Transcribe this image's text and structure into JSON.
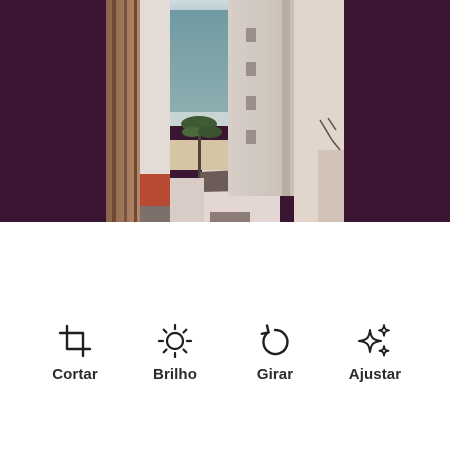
{
  "preview": {
    "background": "#3a1632",
    "image_content": "beach-street-view-photo"
  },
  "toolbar": {
    "icon_color": "#1f1f1f",
    "label_color": "#2b2b2b",
    "tools": [
      {
        "label": "Cortar",
        "icon": "crop-icon"
      },
      {
        "label": "Brilho",
        "icon": "brightness-icon"
      },
      {
        "label": "Girar",
        "icon": "rotate-icon"
      },
      {
        "label": "Ajustar",
        "icon": "sparkle-adjust-icon"
      }
    ]
  }
}
